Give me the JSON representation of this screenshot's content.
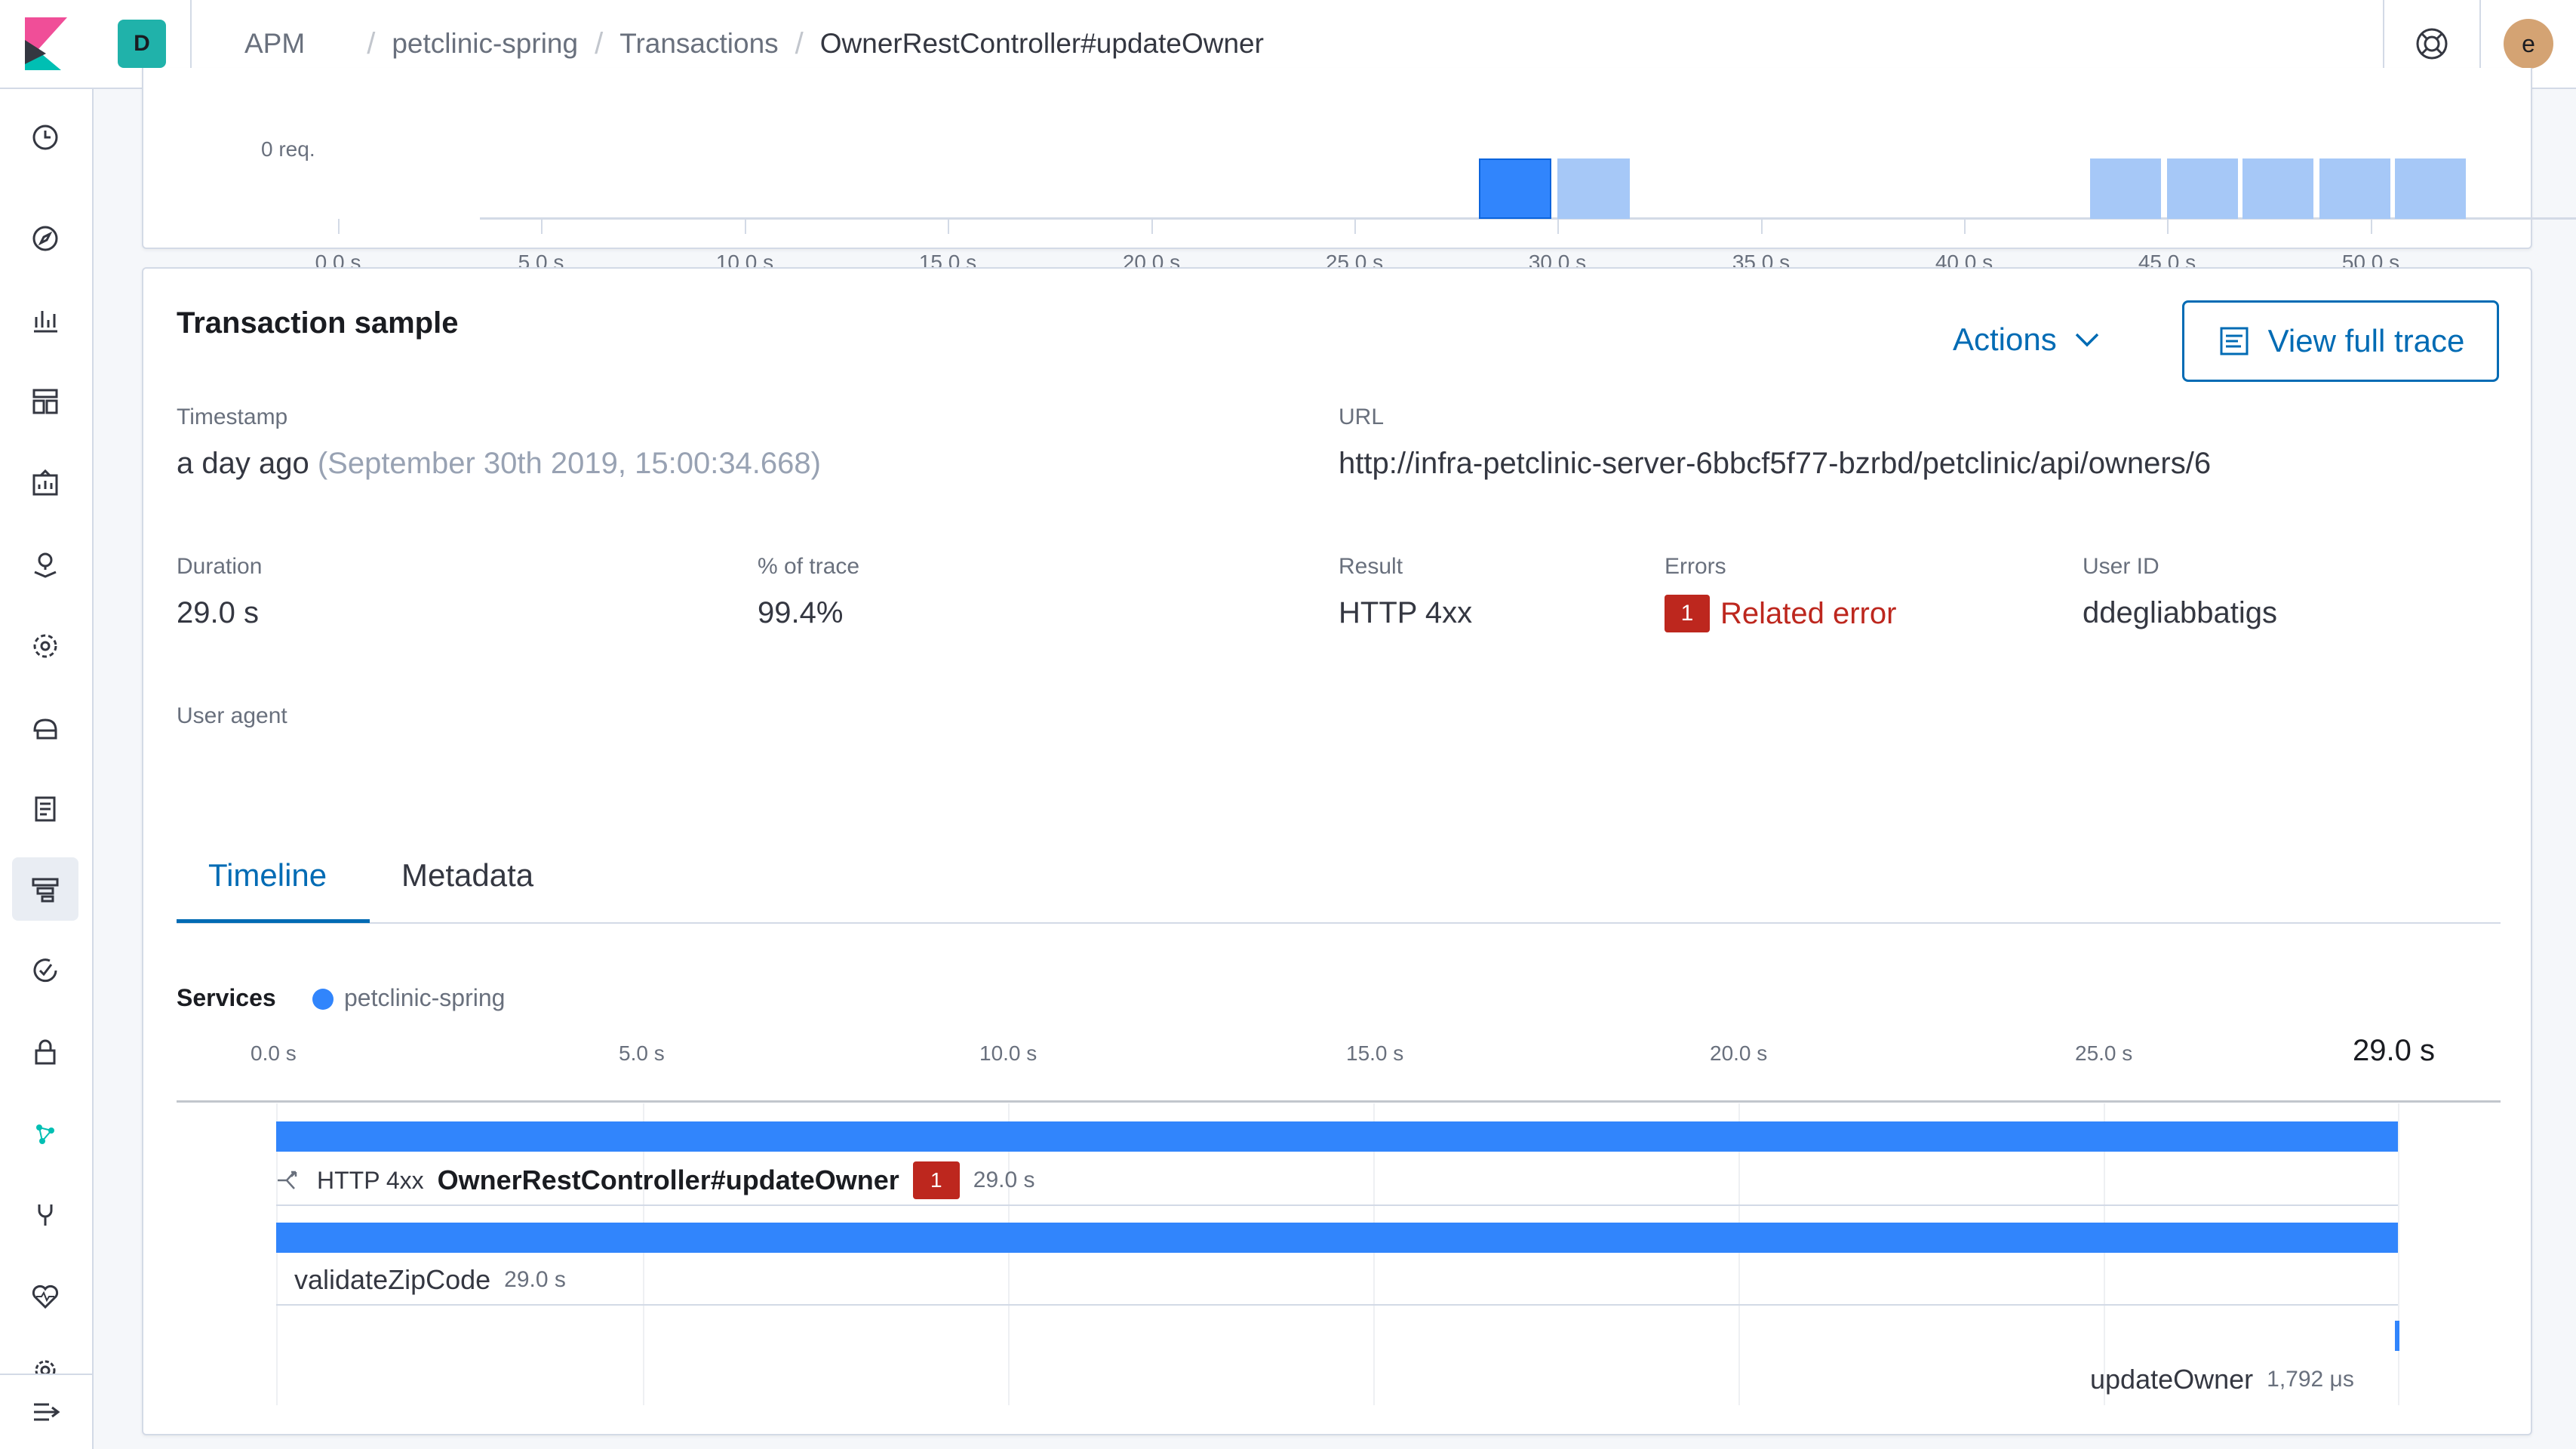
{
  "header": {
    "space_initial": "D",
    "breadcrumbs": [
      "APM",
      "petclinic-spring",
      "Transactions",
      "OwnerRestController#updateOwner"
    ],
    "user_initial": "e"
  },
  "histogram": {
    "y_label": "0 req.",
    "ticks": [
      "0.0 s",
      "5.0 s",
      "10.0 s",
      "15.0 s",
      "20.0 s",
      "25.0 s",
      "30.0 s",
      "35.0 s",
      "40.0 s",
      "45.0 s",
      "50.0 s"
    ]
  },
  "sample": {
    "title": "Transaction sample",
    "actions_label": "Actions",
    "view_trace_label": "View full trace",
    "timestamp_label": "Timestamp",
    "timestamp_value": "a day ago",
    "timestamp_detail": "(September 30th 2019, 15:00:34.668)",
    "url_label": "URL",
    "url_value": "http://infra-petclinic-server-6bbcf5f77-bzrbd/petclinic/api/owners/6",
    "duration_label": "Duration",
    "duration_value": "29.0 s",
    "pct_label": "% of trace",
    "pct_value": "99.4%",
    "result_label": "Result",
    "result_value": "HTTP 4xx",
    "errors_label": "Errors",
    "errors_count": "1",
    "errors_link": "Related error",
    "userid_label": "User ID",
    "userid_value": "ddegliabbatigs",
    "useragent_label": "User agent"
  },
  "tabs": [
    "Timeline",
    "Metadata"
  ],
  "timeline": {
    "services_label": "Services",
    "service_name": "petclinic-spring",
    "ticks": [
      "0.0 s",
      "5.0 s",
      "10.0 s",
      "15.0 s",
      "20.0 s",
      "25.0 s"
    ],
    "end_label": "29.0 s",
    "rows": [
      {
        "status": "HTTP 4xx",
        "name": "OwnerRestController#updateOwner",
        "errors": "1",
        "duration": "29.0 s"
      },
      {
        "name": "validateZipCode",
        "duration": "29.0 s"
      },
      {
        "name": "updateOwner",
        "duration": "1,792 μs"
      }
    ]
  },
  "nav_icons": [
    "clock-icon",
    "compass-icon",
    "visualize-icon",
    "dashboard-icon",
    "canvas-icon",
    "maps-icon",
    "ml-icon",
    "infra-icon",
    "logs-icon",
    "apm-icon",
    "uptime-icon",
    "siem-icon",
    "graph-icon",
    "devtools-icon",
    "monitoring-icon",
    "management-icon",
    "collapse-icon"
  ]
}
